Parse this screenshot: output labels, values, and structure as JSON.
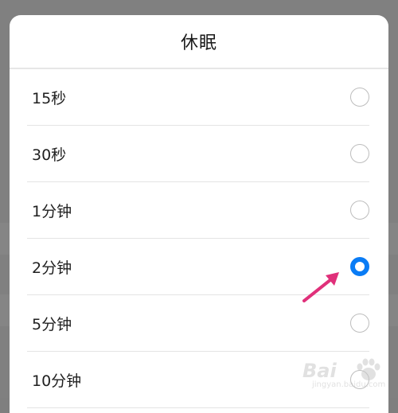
{
  "dialog": {
    "title": "休眠",
    "options": [
      {
        "label": "15秒",
        "selected": false
      },
      {
        "label": "30秒",
        "selected": false
      },
      {
        "label": "1分钟",
        "selected": false
      },
      {
        "label": "2分钟",
        "selected": true
      },
      {
        "label": "5分钟",
        "selected": false
      },
      {
        "label": "10分钟",
        "selected": false
      }
    ]
  },
  "colors": {
    "accent": "#0a7cf5",
    "arrow": "#e0307a",
    "radio_border": "#bdbdbd"
  },
  "watermark": {
    "text": "Bai",
    "sub": "jingyan.baidu.com"
  }
}
